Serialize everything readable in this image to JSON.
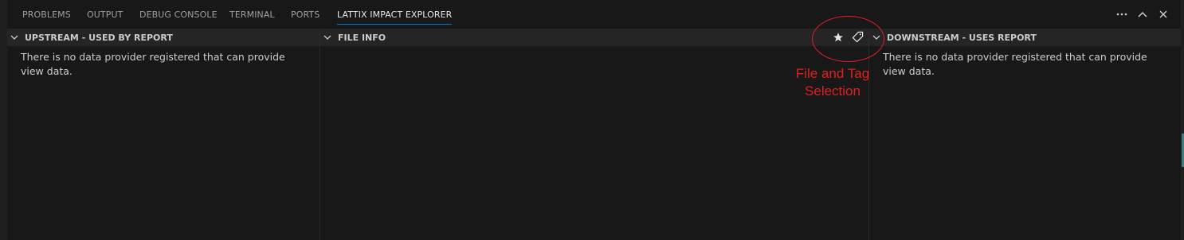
{
  "tabs": [
    {
      "label": "PROBLEMS",
      "active": false
    },
    {
      "label": "OUTPUT",
      "active": false
    },
    {
      "label": "DEBUG CONSOLE",
      "active": false
    },
    {
      "label": "TERMINAL",
      "active": false
    },
    {
      "label": "PORTS",
      "active": false
    },
    {
      "label": "LATTIX IMPACT EXPLORER",
      "active": true
    }
  ],
  "panel_actions": [
    "more-actions-icon",
    "maximize-panel-icon",
    "close-panel-icon"
  ],
  "sections": {
    "upstream": {
      "title": "UPSTREAM - USED BY REPORT",
      "message": "There is no data provider registered that can provide view data."
    },
    "file_info": {
      "title": "FILE INFO",
      "icons": [
        "star-icon",
        "tag-icon"
      ]
    },
    "downstream": {
      "title": "DOWNSTREAM - USES REPORT",
      "message": "There is no data provider registered that can provide view data."
    }
  },
  "annotation": {
    "line1": "File and Tag",
    "line2": "Selection",
    "color": "#e02020"
  },
  "colors": {
    "background": "#181818",
    "header_background": "#252526",
    "active_tab_underline": "#0078d4"
  }
}
